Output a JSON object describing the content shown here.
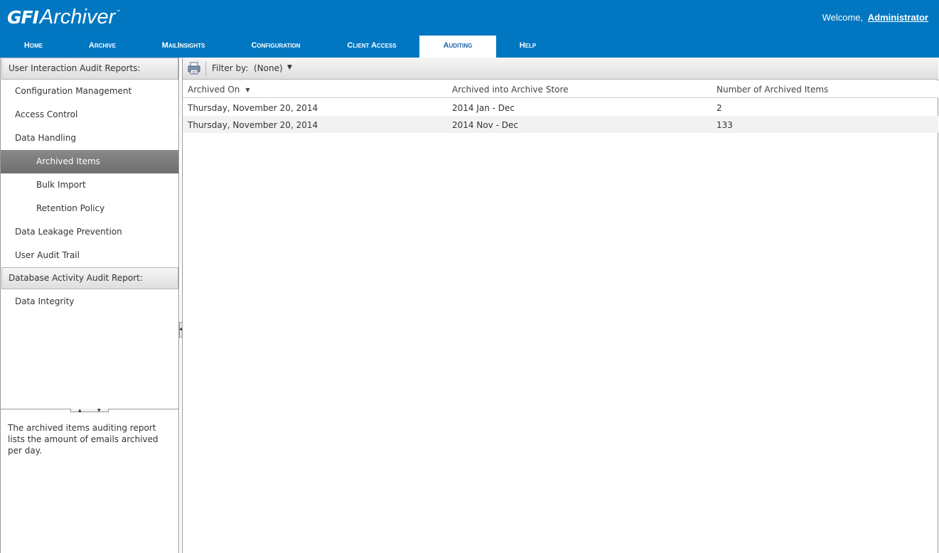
{
  "app": {
    "logo_gfi": "GFI",
    "logo_product": "Archiver",
    "logo_tm": "™",
    "welcome_text": "Welcome,",
    "user_name": "Administrator"
  },
  "nav": {
    "tabs": [
      {
        "label": "Home"
      },
      {
        "label": "Archive"
      },
      {
        "label": "MailInsights"
      },
      {
        "label": "Configuration"
      },
      {
        "label": "Client Access"
      },
      {
        "label": "Auditing",
        "active": true
      },
      {
        "label": "Help"
      }
    ]
  },
  "sidebar": {
    "section1_title": "User Interaction Audit Reports:",
    "items": [
      {
        "label": "Configuration Management"
      },
      {
        "label": "Access Control"
      },
      {
        "label": "Data Handling"
      },
      {
        "label": "Archived Items",
        "selected": true
      },
      {
        "label": "Bulk Import"
      },
      {
        "label": "Retention Policy"
      },
      {
        "label": "Data Leakage Prevention"
      },
      {
        "label": "User Audit Trail"
      }
    ],
    "section2_title": "Database Activity Audit Report:",
    "section2_items": [
      {
        "label": "Data Integrity"
      }
    ],
    "description": "The archived items auditing report lists the amount of emails archived per day."
  },
  "toolbar": {
    "print_icon": "printer-icon",
    "filter_label": "Filter by:",
    "filter_value": "(None)"
  },
  "grid": {
    "columns": [
      "Archived On",
      "Archived into Archive Store",
      "Number of Archived Items"
    ],
    "sort_icon": "sort-descending-icon",
    "rows": [
      [
        "Thursday, November 20, 2014",
        "2014 Jan - Dec",
        "2"
      ],
      [
        "Thursday, November 20, 2014",
        "2014 Nov - Dec",
        "133"
      ]
    ]
  },
  "colors": {
    "header_blue": "#0077c0",
    "selected_gray": "#7a7a7a",
    "active_tab_text": "#1a64a8"
  }
}
